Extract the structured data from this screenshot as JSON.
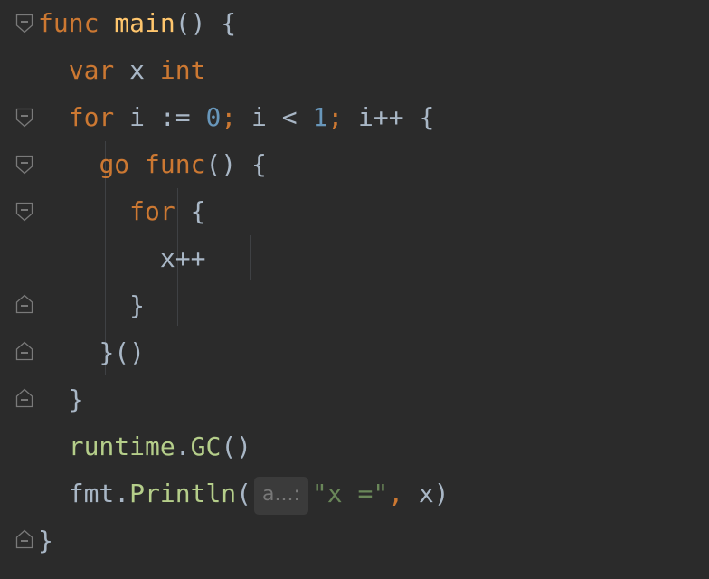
{
  "colors": {
    "background": "#2b2b2b",
    "keyword": "#cc7832",
    "function": "#ffc66d",
    "number": "#6897bb",
    "string": "#6a8759",
    "identifier": "#a9b7c6",
    "package_function": "#b5ce8a"
  },
  "code": {
    "line1": {
      "kw": "func",
      "name": "main",
      "rest": "() {"
    },
    "line2": {
      "kw": "var",
      "var": "x",
      "type": "int"
    },
    "line3": {
      "kw": "for",
      "var": "i",
      "op1": ":=",
      "num1": "0",
      "semi1": ";",
      "cond_var": "i",
      "op2": "<",
      "num2": "1",
      "semi2": ";",
      "inc": "i++",
      "brace": "{"
    },
    "line4": {
      "kw1": "go",
      "kw2": "func",
      "rest": "() {"
    },
    "line5": {
      "kw": "for",
      "brace": "{"
    },
    "line6": {
      "stmt": "x++"
    },
    "line7": {
      "brace": "}"
    },
    "line8": {
      "text": "}()"
    },
    "line9": {
      "brace": "}"
    },
    "line10": {
      "pkg": "runtime",
      "dot": ".",
      "fn": "GC",
      "parens": "()"
    },
    "line11": {
      "pkg": "fmt",
      "dot": ".",
      "fn": "Println",
      "open": "(",
      "hint": "a...:",
      "str": "\"x =\"",
      "comma": ",",
      "arg": "x",
      "close": ")"
    },
    "line12": {
      "brace": "}"
    }
  },
  "fold_markers": [
    {
      "line": 1,
      "kind": "open"
    },
    {
      "line": 3,
      "kind": "open"
    },
    {
      "line": 4,
      "kind": "open"
    },
    {
      "line": 5,
      "kind": "open"
    },
    {
      "line": 7,
      "kind": "close"
    },
    {
      "line": 8,
      "kind": "close"
    },
    {
      "line": 9,
      "kind": "close"
    },
    {
      "line": 12,
      "kind": "close"
    }
  ]
}
